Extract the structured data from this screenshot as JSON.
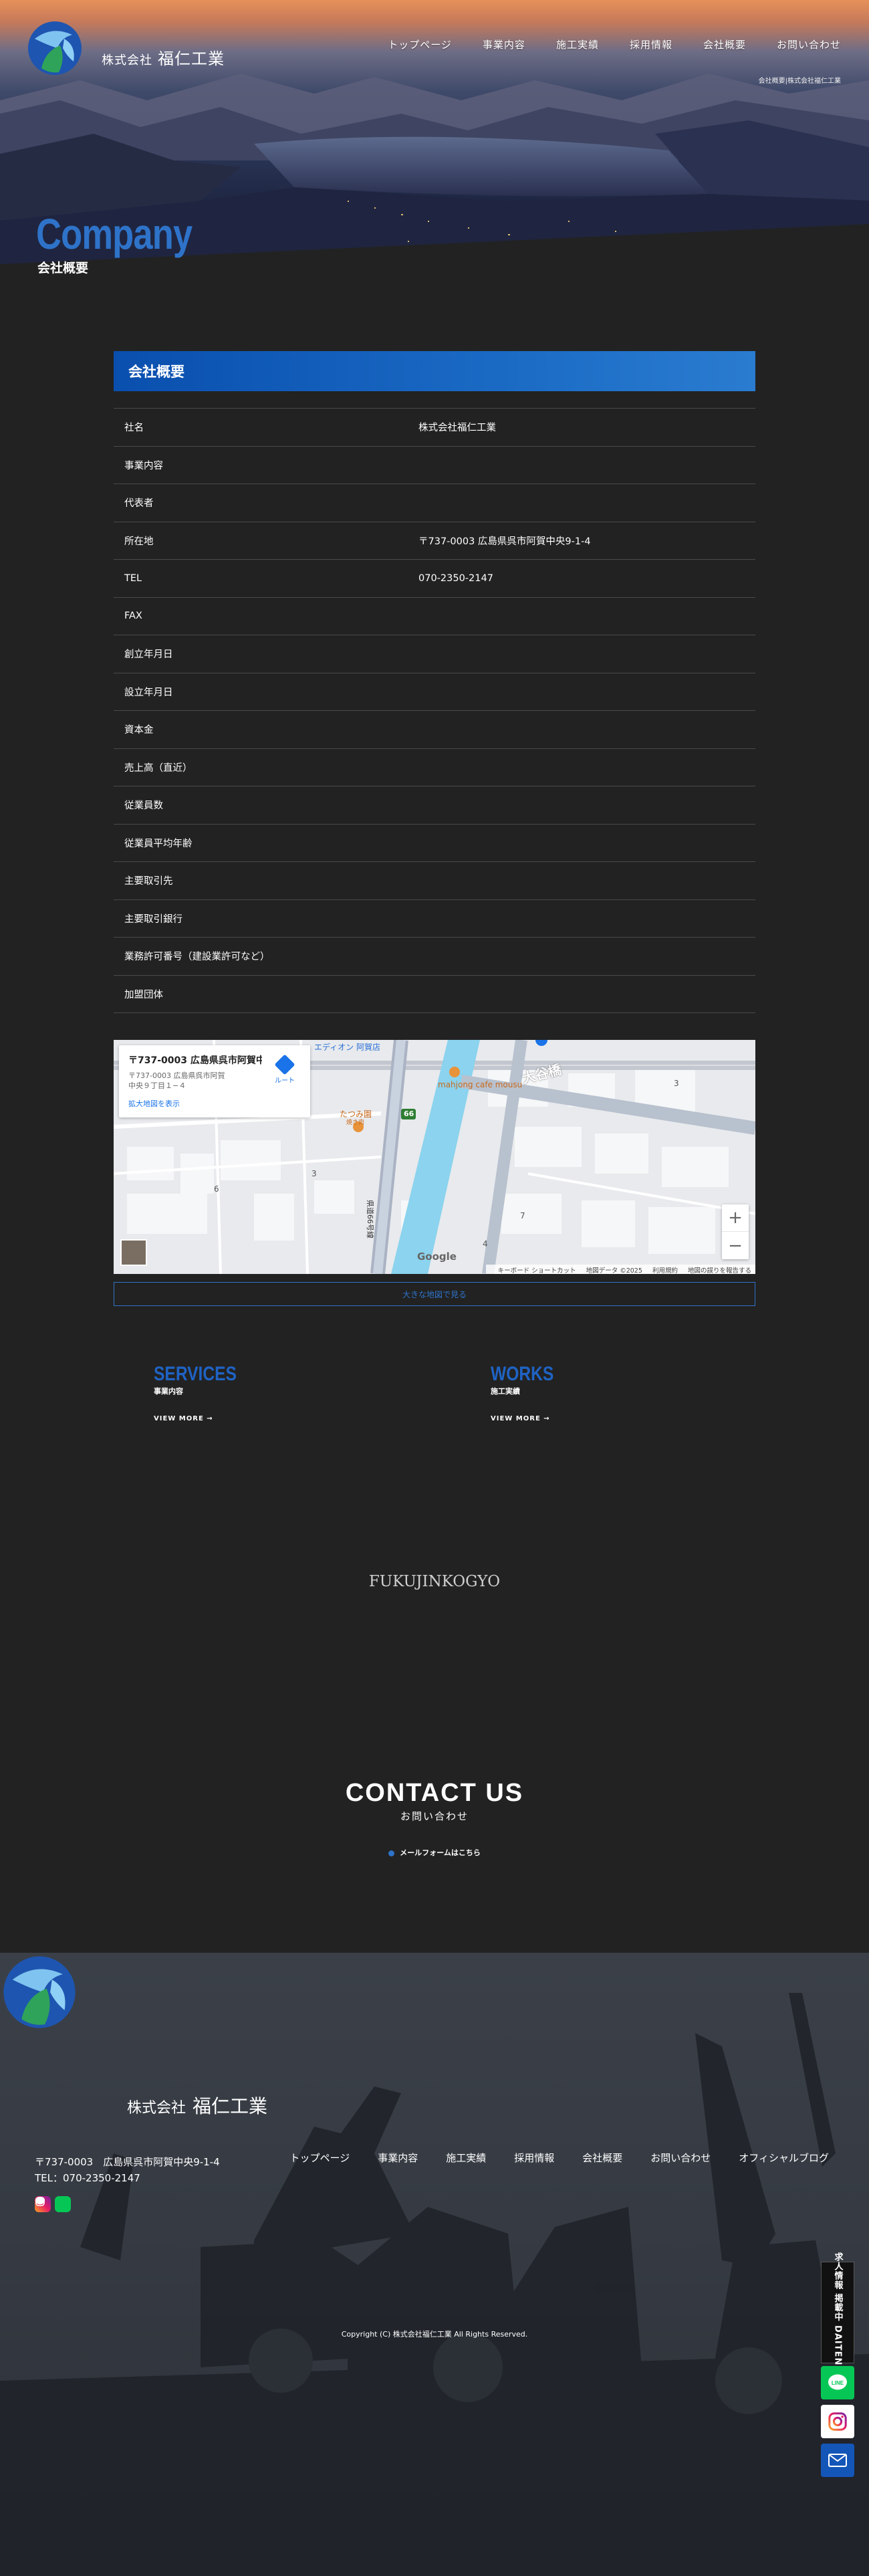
{
  "header": {
    "company_prefix": "株式会社",
    "company_name": "福仁工業",
    "nav": [
      "トップページ",
      "事業内容",
      "施工実績",
      "採用情報",
      "会社概要",
      "お問い合わせ"
    ],
    "breadcrumb": "会社概要|株式会社福仁工業"
  },
  "hero": {
    "title": "Company",
    "subtitle": "会社概要"
  },
  "overview": {
    "heading": "会社概要",
    "rows": [
      {
        "label": "社名",
        "value": "株式会社福仁工業"
      },
      {
        "label": "事業内容",
        "value": ""
      },
      {
        "label": "代表者",
        "value": ""
      },
      {
        "label": "所在地",
        "value": "〒737-0003 広島県呉市阿賀中央9-1-4"
      },
      {
        "label": "TEL",
        "value": "070-2350-2147"
      },
      {
        "label": "FAX",
        "value": ""
      },
      {
        "label": "創立年月日",
        "value": ""
      },
      {
        "label": "設立年月日",
        "value": ""
      },
      {
        "label": "資本金",
        "value": ""
      },
      {
        "label": "売上高（直近）",
        "value": ""
      },
      {
        "label": "従業員数",
        "value": ""
      },
      {
        "label": "従業員平均年齢",
        "value": ""
      },
      {
        "label": "主要取引先",
        "value": ""
      },
      {
        "label": "主要取引銀行",
        "value": ""
      },
      {
        "label": "業務許可番号（建設業許可など）",
        "value": ""
      },
      {
        "label": "加盟団体",
        "value": ""
      }
    ]
  },
  "map": {
    "card_title": "〒737-0003 広島県呉市阿賀中...",
    "card_address": "〒737-0003 広島県呉市阿賀中央９丁目１−４",
    "route_label": "ルート",
    "enlarge_label": "拡大地図を表示",
    "labels": {
      "store": "エディオン 阿賀店",
      "bridge": "大谷橋",
      "cafe": "mahjong cafe mousu",
      "restaurant": "たつみ園",
      "restaurant_sub": "焼き肉",
      "route_no": "66",
      "road": "県道66号線",
      "n1": "3",
      "n2": "6",
      "n3": "3",
      "n4": "7",
      "n5": "4"
    },
    "google": "Google",
    "footer": [
      "キーボード ショートカット",
      "地図データ ©2025",
      "利用規約",
      "地図の誤りを報告する"
    ],
    "zoom_in": "+",
    "zoom_out": "−",
    "link_label": "大きな地図で見る"
  },
  "services": {
    "title": "SERVICES",
    "sub": "事業内容",
    "more": "VIEW MORE →"
  },
  "works": {
    "title": "WORKS",
    "sub": "施工実績",
    "more": "VIEW MORE →"
  },
  "brand": "FUKUJINKOGYO",
  "contact": {
    "title": "CONTACT US",
    "sub": "お問い合わせ",
    "link": "メールフォームはこちら"
  },
  "footer": {
    "company_prefix": "株式会社",
    "company_name": "福仁工業",
    "address": "〒737-0003　広島県呉市阿賀中央9-1-4",
    "tel": "TEL：070-2350-2147",
    "nav": [
      "トップページ",
      "事業内容",
      "施工実績",
      "採用情報",
      "会社概要",
      "お問い合わせ",
      "オフィシャルブログ"
    ],
    "copyright": "Copyright (C) 株式会社福仁工業 All Rights Reserved."
  },
  "side": {
    "banner": "求人情報 掲載中 DAITENS",
    "line_label": "LINE"
  },
  "colors": {
    "accent": "#2e73c9",
    "line": "#06c755",
    "mail": "#1456b8"
  }
}
